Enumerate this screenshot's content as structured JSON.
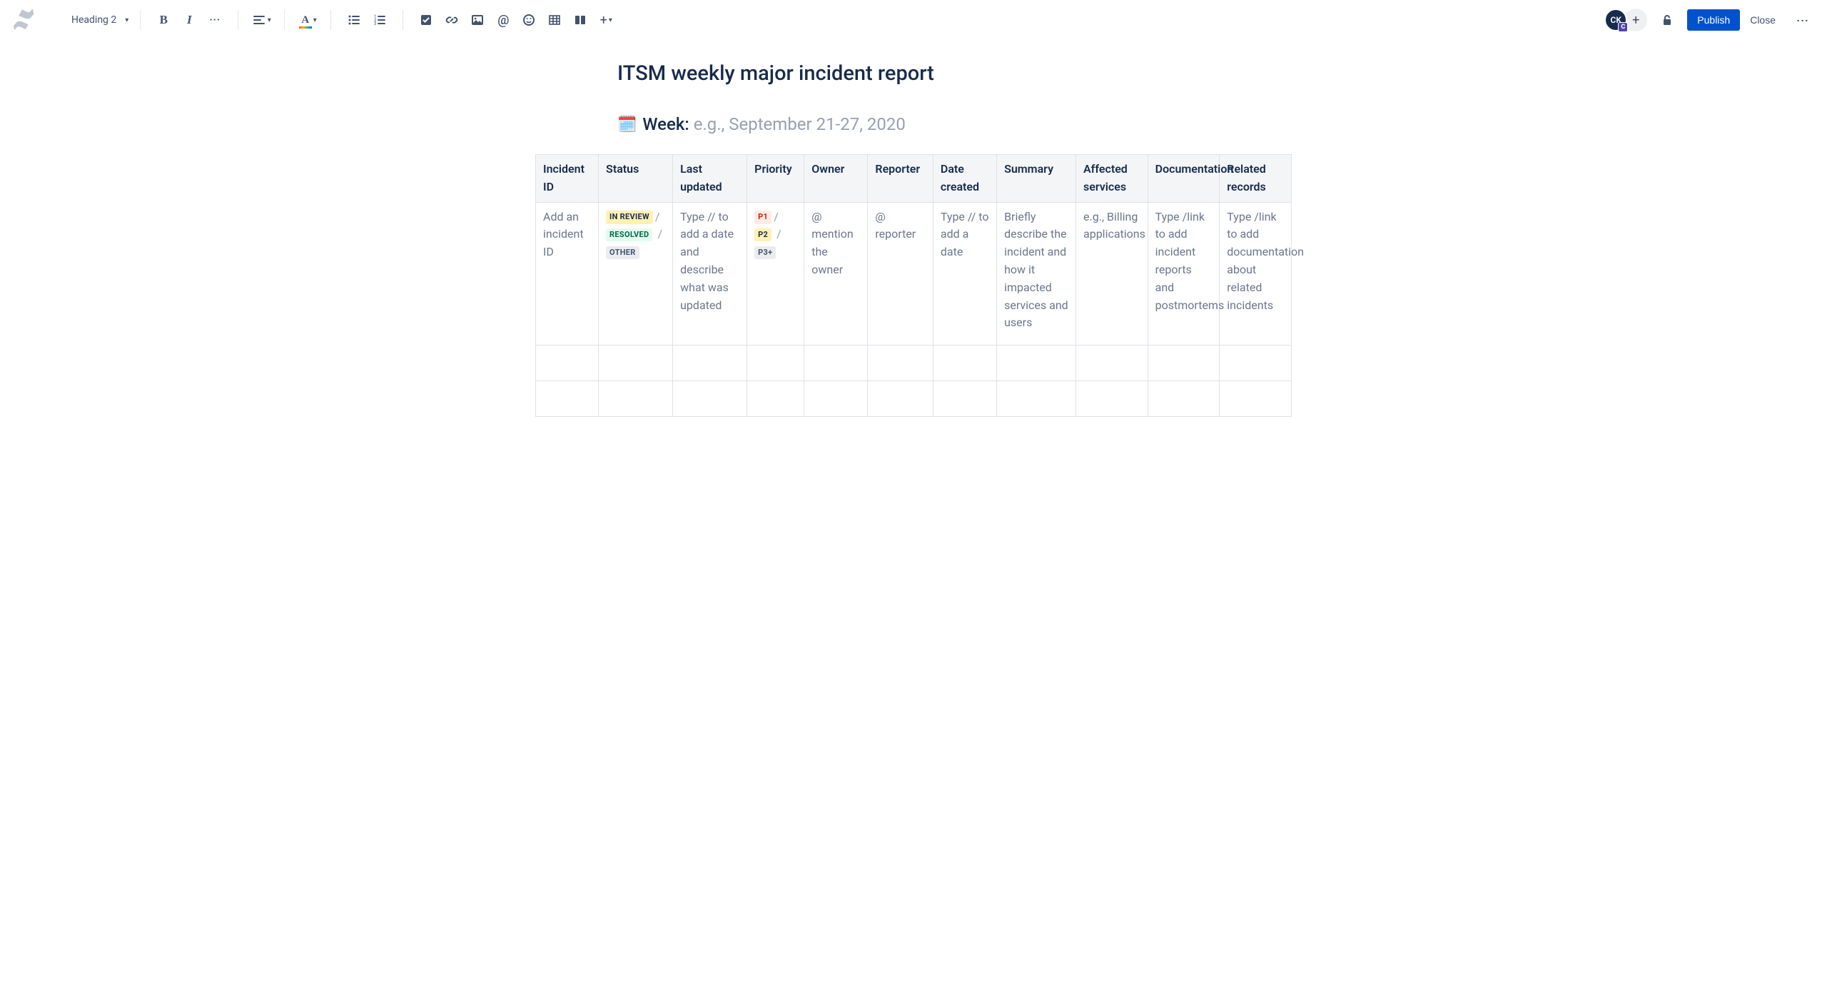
{
  "toolbar": {
    "text_style": "Heading 2",
    "avatar_initials": "CK",
    "avatar_badge": "C",
    "publish_label": "Publish",
    "close_label": "Close"
  },
  "page": {
    "title": "ITSM weekly major incident report",
    "week_label": "Week:",
    "week_placeholder": "e.g., September 21-27, 2020"
  },
  "table": {
    "headers": {
      "incident_id": "Incident ID",
      "status": "Status",
      "last_updated": "Last updated",
      "priority": "Priority",
      "owner": "Owner",
      "reporter": "Reporter",
      "date_created": "Date created",
      "summary": "Summary",
      "affected": "Affected services",
      "documentation": "Documentation",
      "related": "Related records"
    },
    "row": {
      "incident_id": "Add an incident ID",
      "status_in_review": "IN REVIEW",
      "status_resolved": "RESOLVED",
      "status_other": "OTHER",
      "last_updated": "Type // to add a date and describe what was updated",
      "priority_p1": "P1",
      "priority_p2": "P2",
      "priority_p3": "P3+",
      "owner": "@ mention the owner",
      "reporter": "@ reporter",
      "date_created": "Type // to add a date",
      "summary": "Briefly describe the incident and how it impacted services and users",
      "affected": "e.g., Billing applications",
      "documentation": "Type /link to add incident reports and postmortems",
      "related": "Type /link to add documentation about related incidents"
    }
  }
}
